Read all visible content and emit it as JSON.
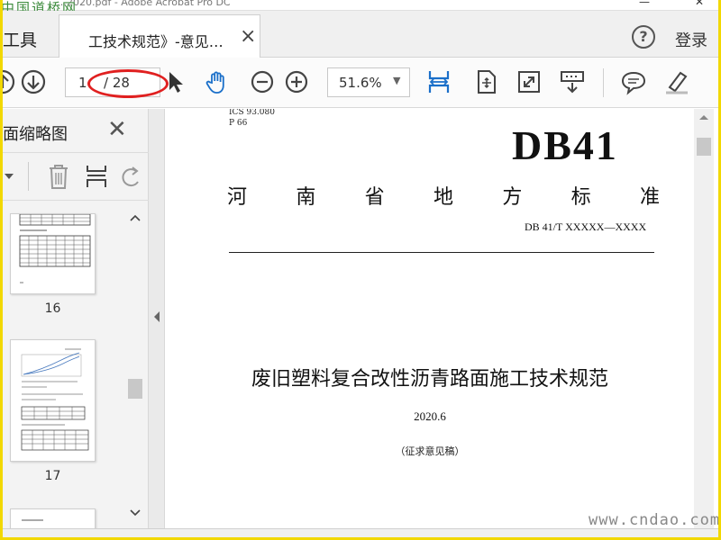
{
  "window": {
    "title": "…2020.pdf - Adobe Acrobat Pro DC",
    "watermark_top": "中国道桥网",
    "minimize_glyph": "—",
    "close_glyph": "✕"
  },
  "tabbar": {
    "tools_label": "工具",
    "tab_label": "工技术规范》-意见…",
    "tab_close": "×",
    "help_glyph": "?",
    "login_label": "登录"
  },
  "toolbar": {
    "current_page": "1",
    "total_pages": "/ 28",
    "zoom": "51.6%",
    "zoom_arrow": "▼",
    "icons": [
      "page-up-icon",
      "page-down-icon",
      "select-arrow-icon",
      "hand-icon",
      "zoom-out-icon",
      "zoom-in-icon",
      "fit-width-icon",
      "fit-page-icon",
      "full-screen-icon",
      "scroll-mode-icon",
      "comment-icon",
      "highlight-icon"
    ]
  },
  "left_panel": {
    "title": "面缩略图",
    "close_glyph": "✕",
    "thumbnails": [
      {
        "page_label": "16"
      },
      {
        "page_label": "17"
      }
    ]
  },
  "document": {
    "ics_line": "ICS   93.080",
    "p_line": "P  66",
    "db_code": "DB41",
    "province_chars": [
      "河",
      "南",
      "省",
      "地",
      "方",
      "标",
      "准"
    ],
    "standard_number": "DB 41/T  XXXXX—XXXX",
    "title": "废旧塑料复合改性沥青路面施工技术规范",
    "date": "2020.6",
    "draft_note": "（征求意见稿）"
  },
  "watermark_bottom": "www.cndao.com",
  "colors": {
    "frame_border": "#f2d800",
    "annotation_ellipse": "#e02020",
    "accent_blue": "#1a6fc9"
  }
}
